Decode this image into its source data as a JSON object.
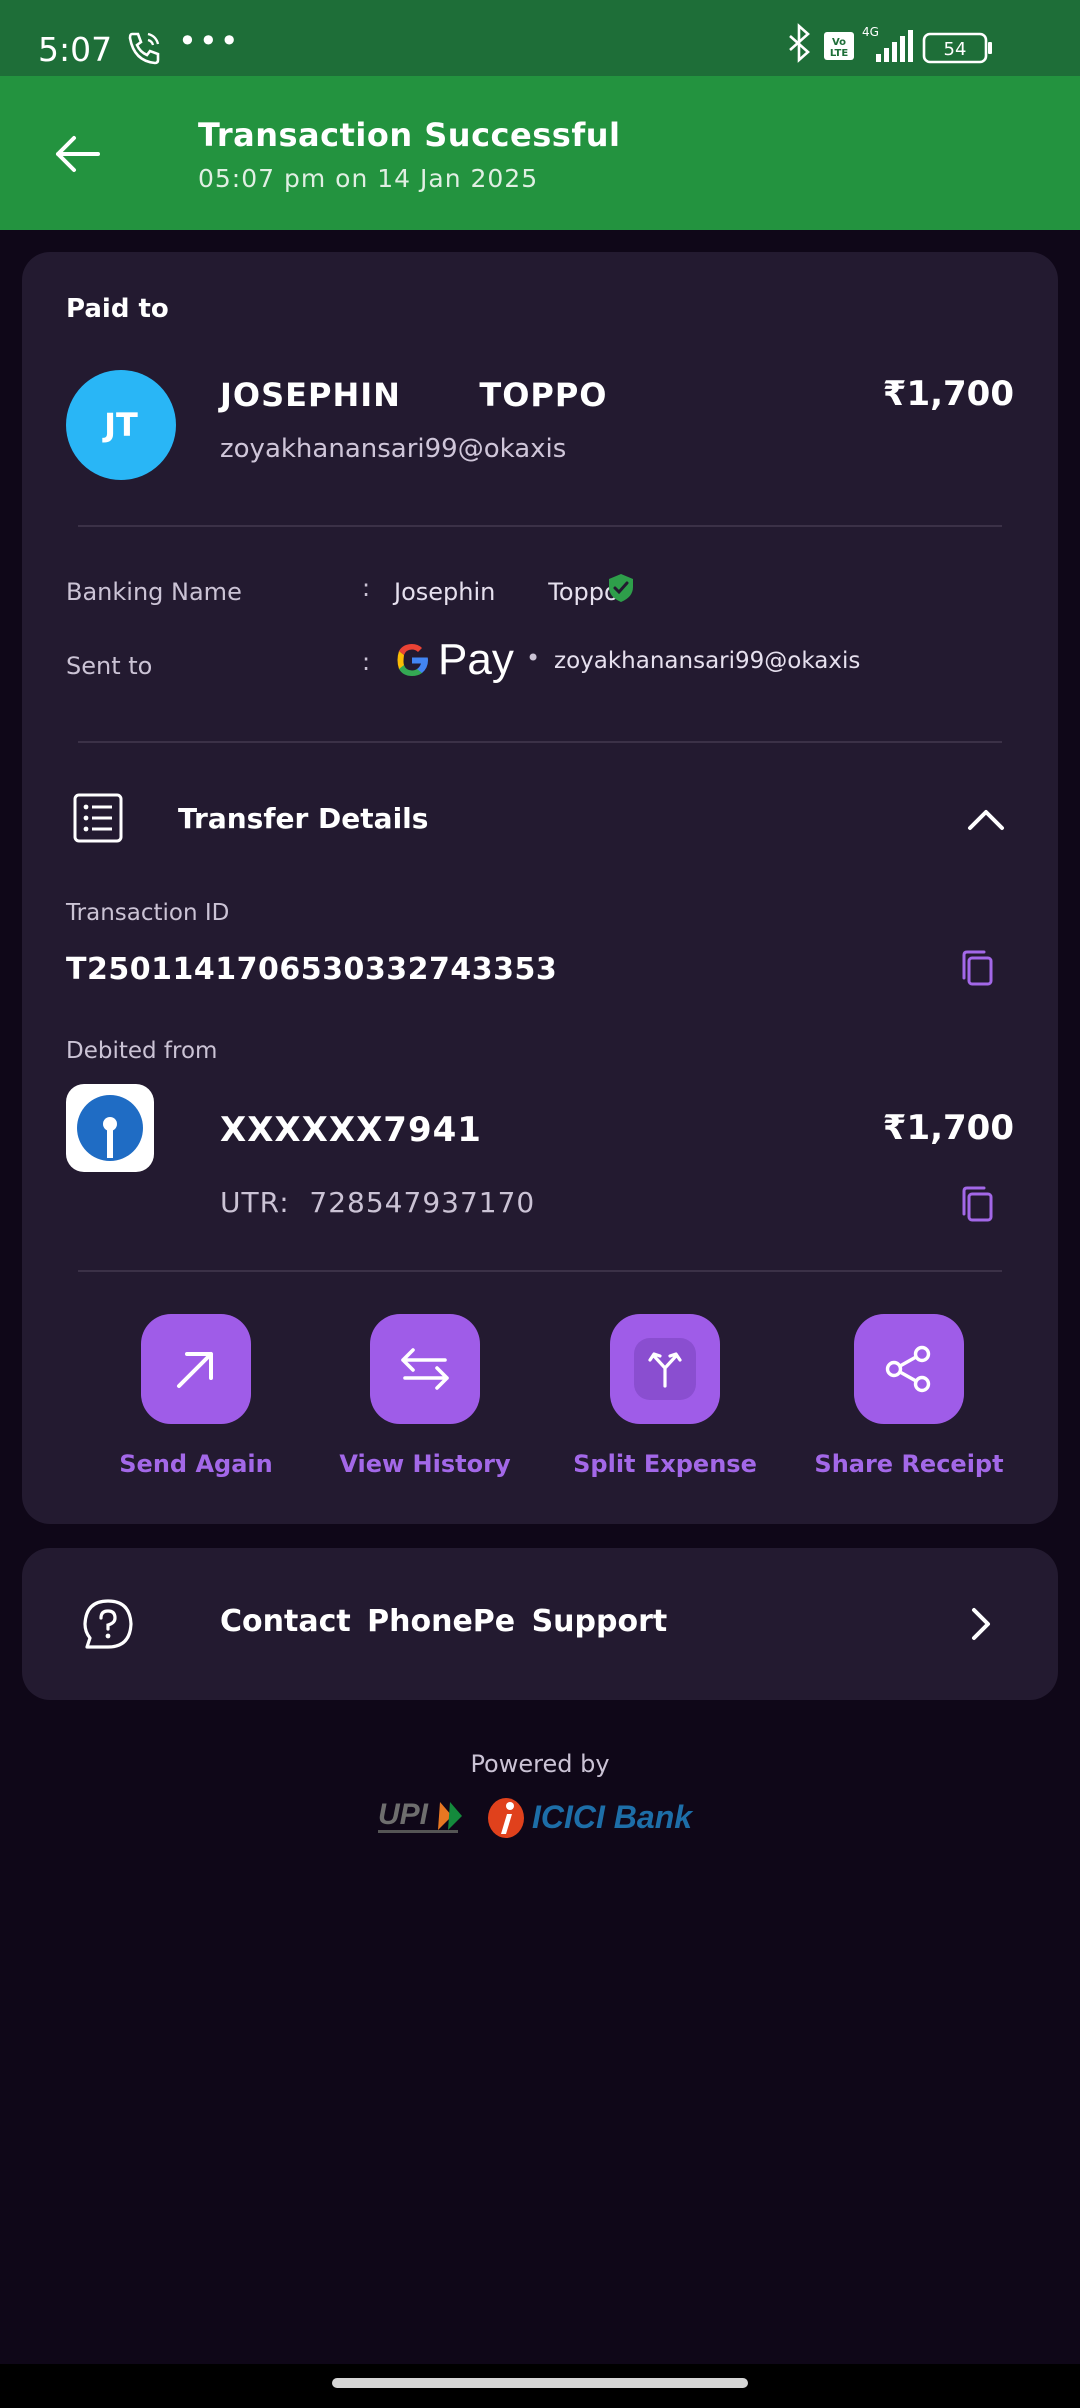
{
  "status_bar": {
    "time": "5:07",
    "dots": "•••",
    "signal_label": "4G",
    "volte_label": "Vo LTE",
    "battery": "54"
  },
  "header": {
    "title": "Transaction Successful",
    "subtitle": "05:07 pm on 14 Jan 2025"
  },
  "payee": {
    "section_label": "Paid to",
    "initials": "JT",
    "name": "JOSEPHIN   TOPPO",
    "upi_id": "zoyakhanansari99@okaxis",
    "amount": "₹1,700",
    "avatar_color": "#29b6f6"
  },
  "details": {
    "banking_name_label": "Banking Name",
    "banking_name_value": "Josephin   Toppo",
    "sent_to_label": "Sent to",
    "colon": ":",
    "sent_to_app": "Pay",
    "bullet": "•",
    "sent_to_upi": "zoyakhanansari99@okaxis"
  },
  "transfer": {
    "title": "Transfer Details",
    "transaction_id_label": "Transaction ID",
    "transaction_id": "T2501141706530332743353",
    "debited_from_label": "Debited from",
    "account_number": "XXXXXX7941",
    "account_amount": "₹1,700",
    "utr": "UTR:  728547937170"
  },
  "actions": [
    {
      "label": "Send Again",
      "icon": "arrow-up-right-icon"
    },
    {
      "label": "View History",
      "icon": "swap-arrows-icon"
    },
    {
      "label": "Split Expense",
      "icon": "split-icon"
    },
    {
      "label": "Share Receipt",
      "icon": "share-icon"
    }
  ],
  "support": {
    "label": "Contact PhonePe Support"
  },
  "footer": {
    "powered_by": "Powered by",
    "upi_text": "UPI",
    "bank_name": "ICICI Bank"
  },
  "colors": {
    "header_green": "#23933f",
    "status_green": "#1e6e38",
    "card_bg": "#231a30",
    "accent_purple": "#9f5ce8",
    "page_bg": "#0f0718"
  }
}
